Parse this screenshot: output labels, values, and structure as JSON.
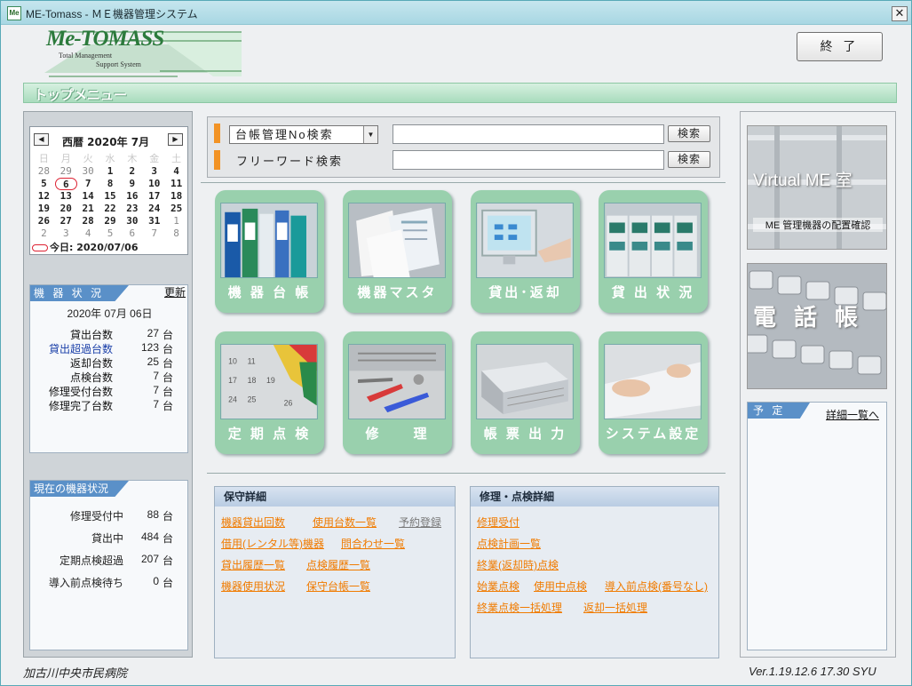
{
  "window": {
    "title": "ME-Tomass - ＭＥ機器管理システム",
    "close": "✕",
    "icon_text": "Me"
  },
  "logo": {
    "name": "Me-TOMASS",
    "line1": "Total  Management",
    "line2": "Support  System"
  },
  "exit_button": "終 了",
  "topmenu_label": "トップメニュー",
  "calendar": {
    "prev": "◀",
    "next": "▶",
    "title": "西暦 2020年 7月",
    "headers": [
      "日",
      "月",
      "火",
      "水",
      "木",
      "金",
      "土"
    ],
    "weeks": [
      [
        "28",
        "29",
        "30",
        "1",
        "2",
        "3",
        "4"
      ],
      [
        "5",
        "6",
        "7",
        "8",
        "9",
        "10",
        "11"
      ],
      [
        "12",
        "13",
        "14",
        "15",
        "16",
        "17",
        "18"
      ],
      [
        "19",
        "20",
        "21",
        "22",
        "23",
        "24",
        "25"
      ],
      [
        "26",
        "27",
        "28",
        "29",
        "30",
        "31",
        "1"
      ],
      [
        "2",
        "3",
        "4",
        "5",
        "6",
        "7",
        "8"
      ]
    ],
    "today_label": "今日: 2020/07/06"
  },
  "device_status": {
    "header": "機 器 状 況",
    "refresh": "更新",
    "date": "2020年 07月 06日",
    "rows": [
      {
        "label": "貸出台数",
        "value": "27",
        "unit": "台",
        "color": "#111"
      },
      {
        "label": "貸出超過台数",
        "value": "123",
        "unit": "台",
        "color": "#1a3fa8"
      },
      {
        "label": "返却台数",
        "value": "25",
        "unit": "台",
        "color": "#111"
      },
      {
        "label": "点検台数",
        "value": "7",
        "unit": "台",
        "color": "#111"
      },
      {
        "label": "修理受付台数",
        "value": "7",
        "unit": "台",
        "color": "#111"
      },
      {
        "label": "修理完了台数",
        "value": "7",
        "unit": "台",
        "color": "#111"
      }
    ]
  },
  "current_status": {
    "header": "現在の機器状況",
    "rows": [
      {
        "label": "修理受付中",
        "value": "88",
        "unit": "台"
      },
      {
        "label": "貸出中",
        "value": "484",
        "unit": "台"
      },
      {
        "label": "定期点検超過",
        "value": "207",
        "unit": "台"
      },
      {
        "label": "導入前点検待ち",
        "value": "0",
        "unit": "台"
      }
    ]
  },
  "search": {
    "select_value": "台帳管理No検索",
    "freeword_label": "フリーワード検索",
    "button1": "検索",
    "button2": "検索"
  },
  "tiles": [
    {
      "label": "機 器 台 帳"
    },
    {
      "label": "機器マスタ"
    },
    {
      "label": "貸出･返却"
    },
    {
      "label": "貸 出 状 況"
    },
    {
      "label": "定 期 点 検"
    },
    {
      "label": "修　　理"
    },
    {
      "label": "帳 票 出 力"
    },
    {
      "label": "システム設定"
    }
  ],
  "maintenance": {
    "header": "保守詳細",
    "links": [
      "機器貸出回数",
      "使用台数一覧",
      "予約登録",
      "借用(レンタル等)機器",
      "問合わせ一覧",
      "貸出履歴一覧",
      "点検履歴一覧",
      "機器使用状況",
      "保守台帳一覧"
    ]
  },
  "repair": {
    "header": "修理・点検詳細",
    "links": [
      "修理受付",
      "点検計画一覧",
      "終業(返却時)点検",
      "始業点検",
      "使用中点検",
      "導入前点検(番号なし)",
      "終業点検一括処理",
      "返却一括処理"
    ]
  },
  "virtual_me": {
    "title": "Virtual ME 室",
    "subtitle": "ME 管理機器の配置確認"
  },
  "phonebook": {
    "title": "電話帳"
  },
  "schedule": {
    "header": "予 定",
    "link": "詳細一覧へ"
  },
  "footer": {
    "hospital": "加古川中央市民病院",
    "version": "Ver.1.19.12.6 17.30 SYU"
  }
}
